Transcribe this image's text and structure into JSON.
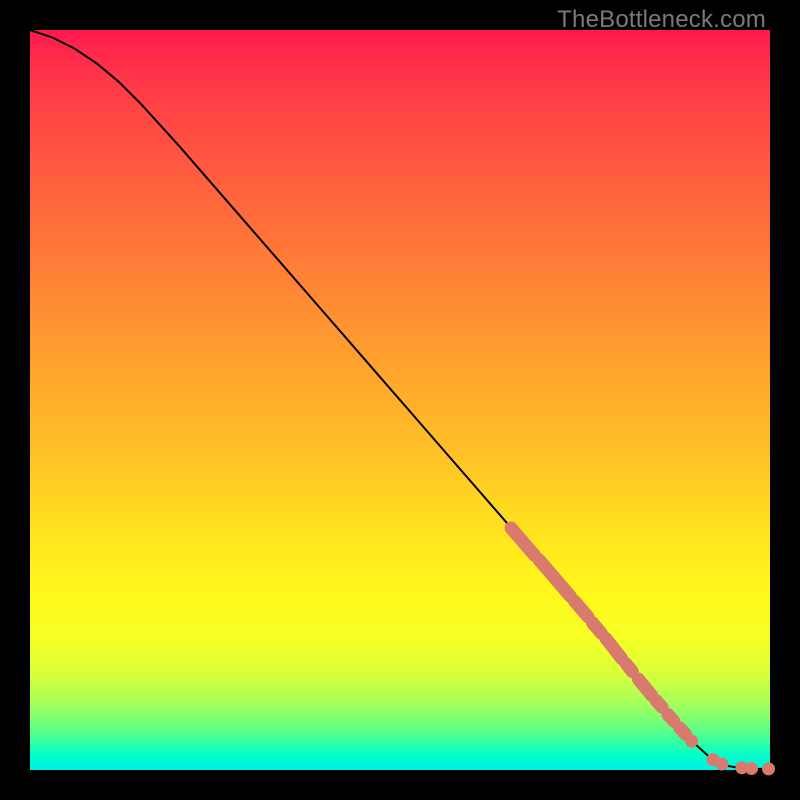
{
  "watermark": "TheBottleneck.com",
  "colors": {
    "background": "#000000",
    "dot": "#d87a6e",
    "curve": "#000000",
    "gradient_top": "#ff1a4d",
    "gradient_bottom": "#00f0e4"
  },
  "chart_data": {
    "type": "line",
    "title": "",
    "xlabel": "",
    "ylabel": "",
    "xlim": [
      0,
      100
    ],
    "ylim": [
      0,
      100
    ],
    "curve": {
      "x": [
        0,
        3,
        6,
        9,
        12,
        15,
        20,
        30,
        40,
        50,
        60,
        70,
        78,
        82,
        85,
        88,
        90,
        92,
        94,
        96,
        98,
        100
      ],
      "y": [
        100,
        99,
        97.5,
        95.5,
        93,
        90,
        84.5,
        73,
        61.5,
        50,
        38.5,
        27,
        17.5,
        12.5,
        9,
        5.7,
        3.4,
        1.6,
        0.6,
        0.25,
        0.15,
        0.15
      ]
    },
    "highlight_segments": [
      {
        "x": [
          65.0,
          68.2
        ],
        "y": [
          32.7,
          29.0
        ]
      },
      {
        "x": [
          68.8,
          73.0
        ],
        "y": [
          28.4,
          23.5
        ]
      },
      {
        "x": [
          73.6,
          75.4
        ],
        "y": [
          22.8,
          20.7
        ]
      },
      {
        "x": [
          76.0,
          77.2
        ],
        "y": [
          19.9,
          18.5
        ]
      },
      {
        "x": [
          77.8,
          80.0
        ],
        "y": [
          17.8,
          15.0
        ]
      },
      {
        "x": [
          80.6,
          81.4
        ],
        "y": [
          14.3,
          13.3
        ]
      },
      {
        "x": [
          82.2,
          84.0
        ],
        "y": [
          12.3,
          10.1
        ]
      },
      {
        "x": [
          84.6,
          85.4
        ],
        "y": [
          9.4,
          8.5
        ]
      },
      {
        "x": [
          86.2,
          87.0
        ],
        "y": [
          7.5,
          6.6
        ]
      },
      {
        "x": [
          87.8,
          88.6
        ],
        "y": [
          5.7,
          4.8
        ]
      }
    ],
    "tail_points": [
      {
        "x": 89.4,
        "y": 3.9
      },
      {
        "x": 92.3,
        "y": 1.4
      },
      {
        "x": 93.5,
        "y": 0.8
      },
      {
        "x": 96.2,
        "y": 0.3
      },
      {
        "x": 97.5,
        "y": 0.2
      },
      {
        "x": 99.8,
        "y": 0.15
      }
    ]
  }
}
